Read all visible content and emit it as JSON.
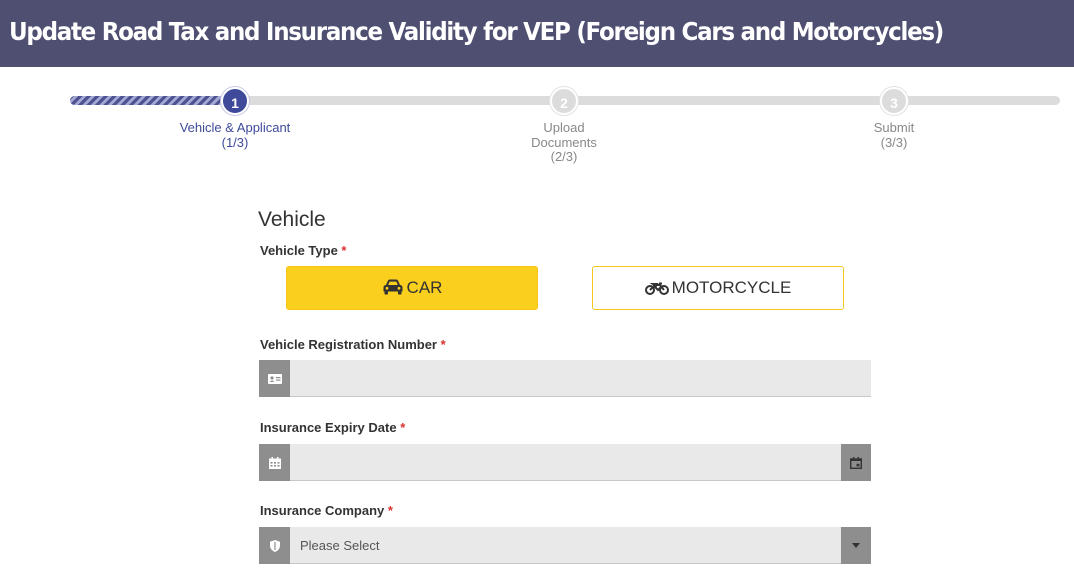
{
  "header": {
    "title": "Update Road Tax and Insurance Validity for VEP (Foreign Cars and Motorcycles)"
  },
  "stepper": {
    "steps": [
      {
        "number": "1",
        "label_lines": [
          "Vehicle & Applicant",
          "(1/3)"
        ],
        "state": "active"
      },
      {
        "number": "2",
        "label_lines": [
          "Upload",
          "Documents",
          "(2/3)"
        ],
        "state": "pending"
      },
      {
        "number": "3",
        "label_lines": [
          "Submit",
          "(3/3)"
        ],
        "state": "pending"
      }
    ]
  },
  "form": {
    "section_title": "Vehicle",
    "required_mark": "*",
    "vehicle_type": {
      "label": "Vehicle Type",
      "options": [
        {
          "label": "CAR",
          "icon": "car-icon",
          "selected": true
        },
        {
          "label": "MOTORCYCLE",
          "icon": "motorcycle-icon",
          "selected": false
        }
      ]
    },
    "registration_number": {
      "label": "Vehicle Registration Number",
      "value": "",
      "icon": "id-card-icon"
    },
    "insurance_expiry": {
      "label": "Insurance Expiry Date",
      "value": "",
      "icon": "calendar-icon",
      "picker_icon": "calendar-picker-icon"
    },
    "insurance_company": {
      "label": "Insurance Company",
      "selected_value": "Please Select",
      "icon": "shield-icon",
      "dropdown_icon": "caret-down-icon"
    }
  },
  "colors": {
    "header_bg": "#4e4f71",
    "accent": "#3f4a9b",
    "selected_button": "#fbcf1e",
    "required": "#d9312f"
  }
}
